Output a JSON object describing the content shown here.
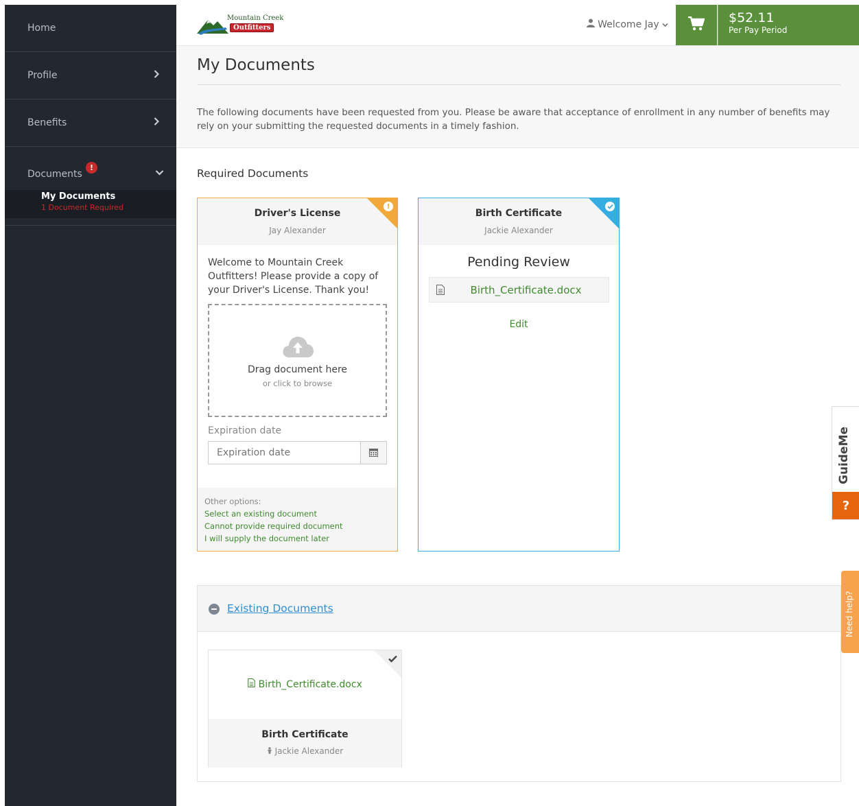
{
  "sidebar": {
    "items": [
      {
        "label": "Home"
      },
      {
        "label": "Profile"
      },
      {
        "label": "Benefits"
      }
    ],
    "documents": {
      "label": "Documents",
      "badge": "!",
      "sub_label": "My Documents",
      "sub_status": "1 Document Required"
    }
  },
  "header": {
    "logo_line1": "Mountain Creek",
    "logo_line2": "Outfitters",
    "welcome": "Welcome Jay",
    "price": "$52.11",
    "price_period": "Per Pay Period"
  },
  "page": {
    "title": "My Documents",
    "description": "The following documents have been requested from you. Please be aware that acceptance of enrollment in any number of benefits may rely on your submitting the requested documents in a timely fashion.",
    "required_title": "Required Documents"
  },
  "cards": [
    {
      "name": "Driver's License",
      "person": "Jay Alexander",
      "intro": "Welcome to Mountain Creek Outfitters! Please provide a copy of your Driver's License. Thank you!",
      "drop_main": "Drag document here",
      "drop_sub": "or click to browse",
      "expiration_label": "Expiration date",
      "expiration_placeholder": "Expiration date",
      "other_label": "Other options:",
      "options": [
        "Select an existing document",
        "Cannot provide required document",
        "I will supply the document later"
      ],
      "accent": "#f2a93b"
    },
    {
      "name": "Birth Certificate",
      "person": "Jackie Alexander",
      "status": "Pending Review",
      "file": "Birth_Certificate.docx",
      "edit": "Edit",
      "accent": "#36aee0"
    }
  ],
  "existing": {
    "title": "Existing Documents",
    "items": [
      {
        "file": "Birth_Certificate.docx",
        "name": "Birth Certificate",
        "person": "Jackie Alexander"
      }
    ]
  },
  "widgets": {
    "guideme": "GuideMe",
    "guideme_q": "?",
    "needhelp": "Need help?"
  },
  "colors": {
    "sidebar_bg": "#232830",
    "green": "#5a8f3c",
    "link_green": "#3f8a2e",
    "warning": "#f2a93b",
    "info": "#36aee0",
    "alert": "#c62a2a",
    "guideme_orange": "#e8650f",
    "needhelp_orange": "#f7a24c"
  }
}
